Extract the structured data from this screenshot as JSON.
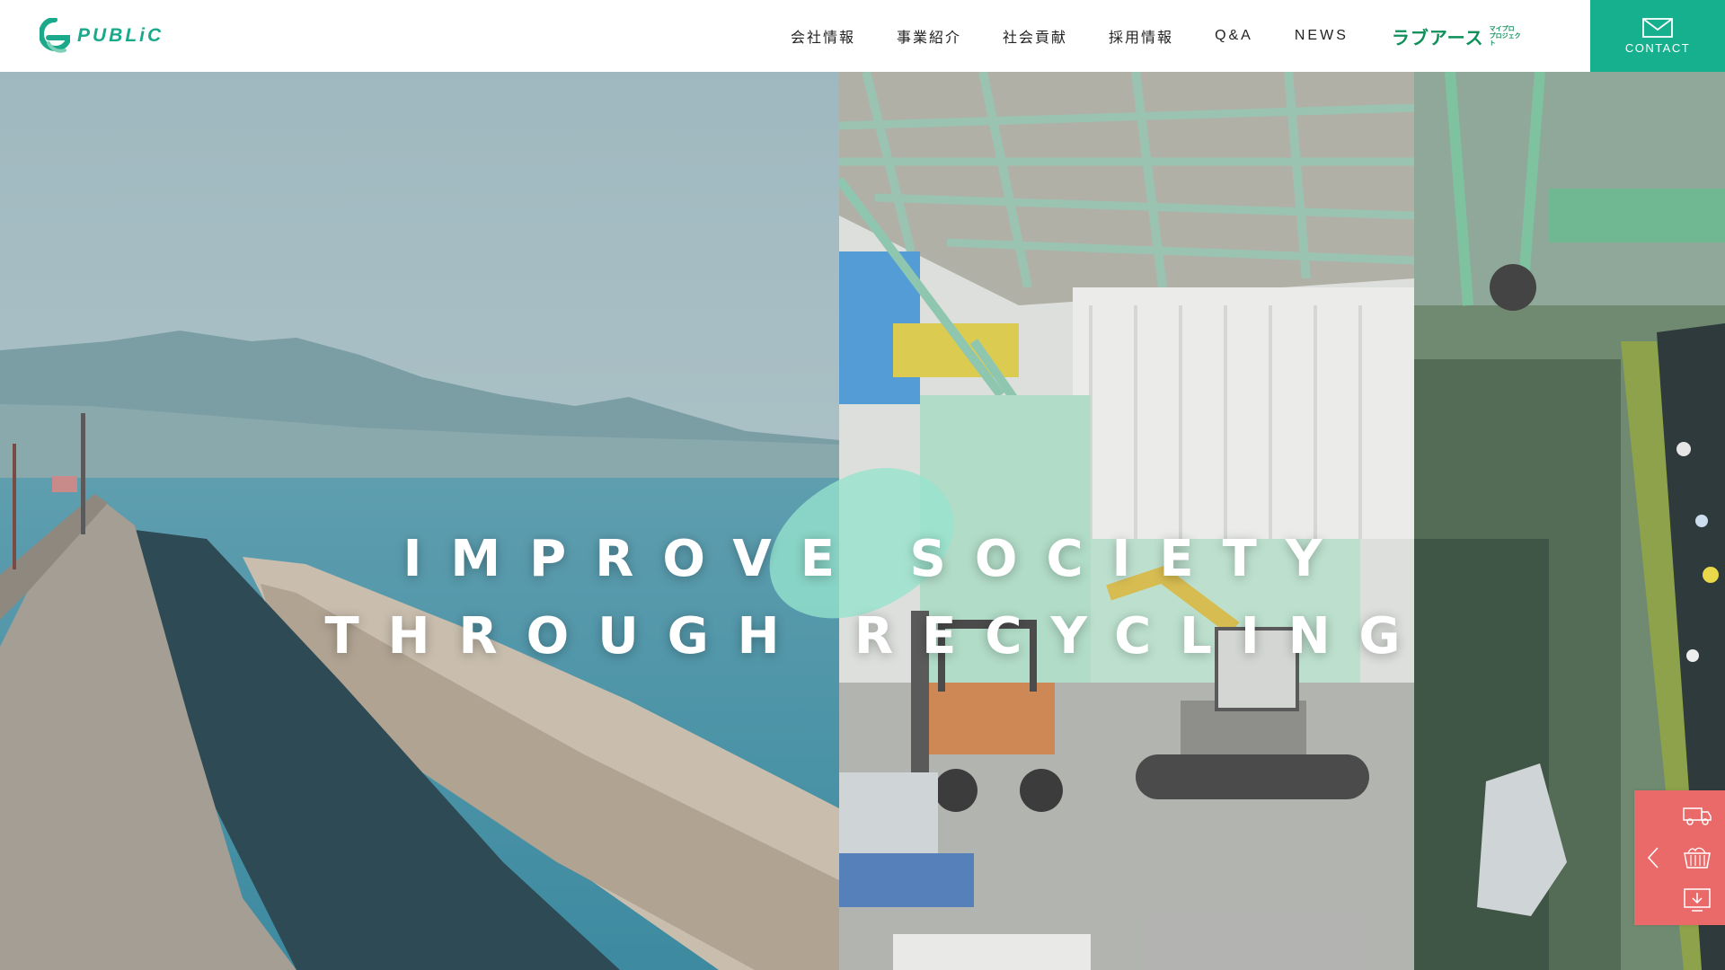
{
  "header": {
    "logo_text": "PUBLiC",
    "nav": [
      {
        "label": "会社情報"
      },
      {
        "label": "事業紹介"
      },
      {
        "label": "社会貢献"
      },
      {
        "label": "採用情報"
      },
      {
        "label": "Q&A"
      },
      {
        "label": "NEWS"
      }
    ],
    "partner_logo": {
      "main": "ラブアース",
      "sub": "マイプロ プロジェクト"
    },
    "contact_label": "CONTACT"
  },
  "hero": {
    "title_line1": "IMPROVE SOCIETY",
    "title_line2": "THROUGH RECYCLING"
  },
  "side_widget": {
    "icons": [
      "arrow-left-icon",
      "truck-icon",
      "container-icon",
      "download-icon"
    ]
  },
  "colors": {
    "accent": "#16b08f",
    "logo": "#1aa98a",
    "partner": "#0f8f5a",
    "widget": "#ea6a6a"
  }
}
